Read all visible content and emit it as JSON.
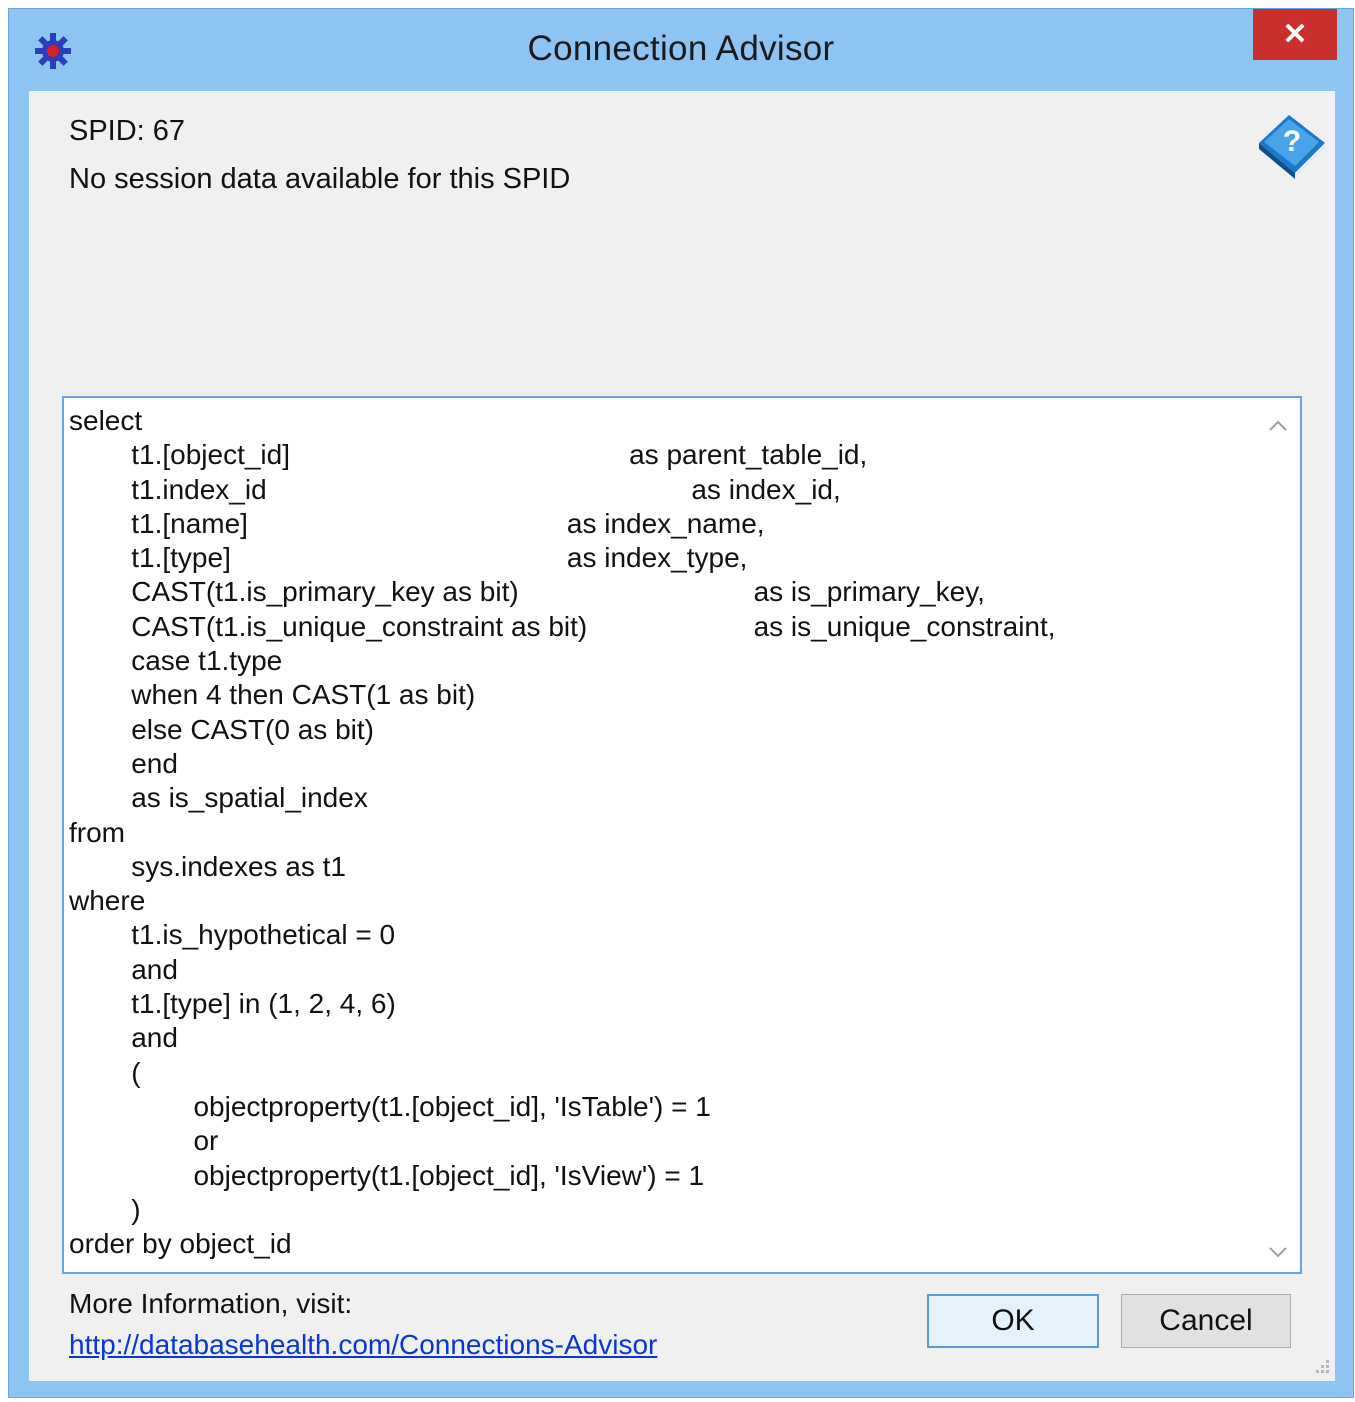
{
  "window": {
    "title": "Connection Advisor",
    "close_glyph": "✕",
    "app_icon": "gear-icon",
    "accent_color": "#8ec4f2",
    "close_color": "#c9302c"
  },
  "header": {
    "spid": "SPID: 67",
    "message": "No session data available for this SPID",
    "help_icon": "help-book-icon"
  },
  "sql": {
    "lines": [
      "select",
      "\tt1.[object_id]\t\t\t\t\t\tas parent_table_id,",
      "\tt1.index_id\t\t\t\t\t\t\tas index_id,",
      "\tt1.[name]\t\t\t\t\t\tas index_name,",
      "\tt1.[type]\t\t\t\t\t\tas index_type,",
      "\tCAST(t1.is_primary_key as bit)\t\t\t\tas is_primary_key,",
      "\tCAST(t1.is_unique_constraint as bit)\t\t\tas is_unique_constraint,",
      "\tcase t1.type",
      "\twhen 4 then CAST(1 as bit)",
      "\telse CAST(0 as bit)",
      "\tend",
      "\tas is_spatial_index",
      "from",
      "\tsys.indexes as t1",
      "where",
      "\tt1.is_hypothetical = 0",
      "\tand",
      "\tt1.[type] in (1, 2, 4, 6)",
      "\tand",
      "\t(",
      "\t\tobjectproperty(t1.[object_id], 'IsTable') = 1",
      "\t\tor",
      "\t\tobjectproperty(t1.[object_id], 'IsView') = 1",
      "\t)",
      "order by object_id"
    ]
  },
  "footer": {
    "more_label": "More Information, visit:",
    "link_text": "http://databasehealth.com/Connections-Advisor",
    "ok_label": "OK",
    "cancel_label": "Cancel"
  }
}
